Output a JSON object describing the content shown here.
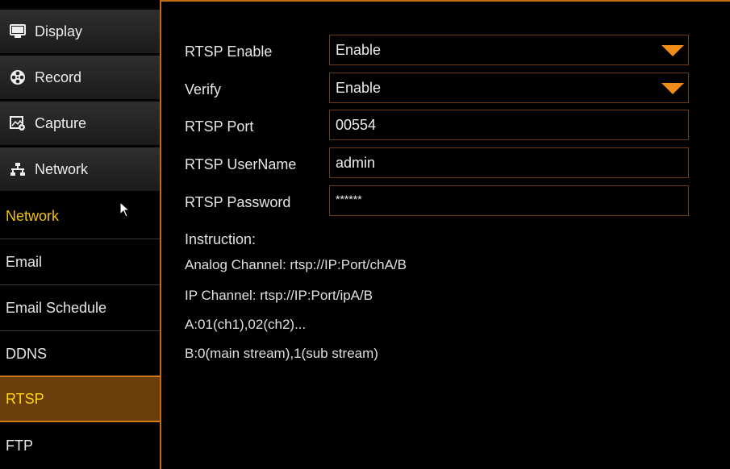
{
  "sidebar": {
    "main_items": [
      {
        "label": "Display",
        "icon": "monitor-icon"
      },
      {
        "label": "Record",
        "icon": "film-reel-icon"
      },
      {
        "label": "Capture",
        "icon": "capture-image-icon"
      },
      {
        "label": "Network",
        "icon": "network-icon"
      }
    ],
    "sub_items": [
      {
        "label": "Network"
      },
      {
        "label": "Email"
      },
      {
        "label": "Email Schedule"
      },
      {
        "label": "DDNS"
      },
      {
        "label": "RTSP"
      },
      {
        "label": "FTP"
      }
    ]
  },
  "form": {
    "rtsp_enable": {
      "label": "RTSP Enable",
      "value": "Enable"
    },
    "verify": {
      "label": "Verify",
      "value": "Enable"
    },
    "rtsp_port": {
      "label": "RTSP Port",
      "value": "00554"
    },
    "rtsp_username": {
      "label": "RTSP UserName",
      "value": "admin"
    },
    "rtsp_password": {
      "label": "RTSP Password",
      "value": "******"
    }
  },
  "instructions": {
    "title": "Instruction:",
    "lines": [
      "Analog Channel:  rtsp://IP:Port/chA/B",
      "IP Channel:  rtsp://IP:Port/ipA/B",
      "A:01(ch1),02(ch2)...",
      "B:0(main stream),1(sub stream)"
    ]
  },
  "colors": {
    "accent": "#f08c1a",
    "selected_bg": "#6a3f0c",
    "selected_text": "#ffd21a",
    "group_text": "#f2c200"
  }
}
